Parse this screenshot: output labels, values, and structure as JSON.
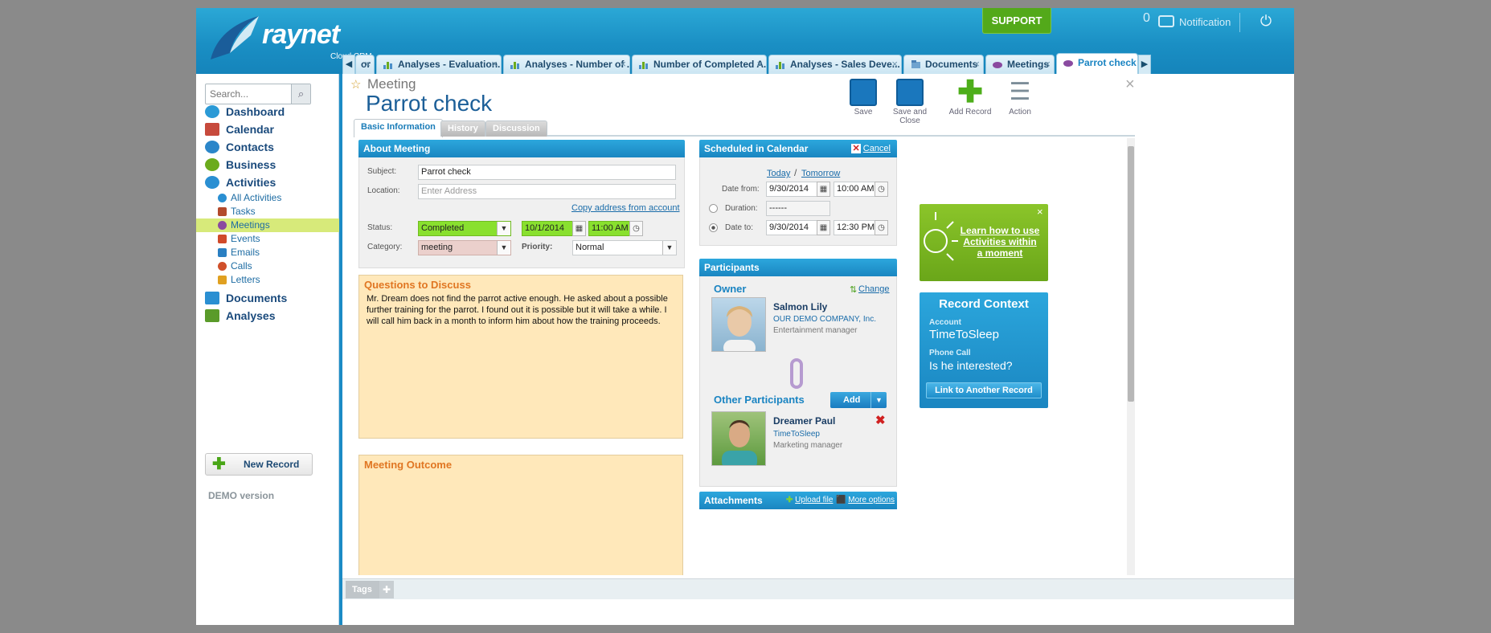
{
  "app": {
    "brand": "raynet",
    "sub": "Cloud CRM"
  },
  "topbar": {
    "support": "SUPPORT",
    "notif_count": "0",
    "notif_label": "Notification"
  },
  "tabs": [
    {
      "label": "or",
      "icon": "chart-icon"
    },
    {
      "label": "Analyses - Evaluation...",
      "icon": "chart-icon"
    },
    {
      "label": "Analyses - Number of ...",
      "icon": "chart-icon"
    },
    {
      "label": "Number of Completed A...",
      "icon": "chart-icon"
    },
    {
      "label": "Analyses - Sales Deve...",
      "icon": "chart-icon"
    },
    {
      "label": "Documents",
      "icon": "document-icon"
    },
    {
      "label": "Meetings",
      "icon": "meeting-icon"
    },
    {
      "label": "Parrot check",
      "icon": "meeting-icon"
    }
  ],
  "sidebar": {
    "search_placeholder": "Search...",
    "nav": [
      {
        "label": "Dashboard",
        "color": "#2b9ad6"
      },
      {
        "label": "Calendar",
        "color": "#c74a3c"
      },
      {
        "label": "Contacts",
        "color": "#2b86c9"
      },
      {
        "label": "Business",
        "color": "#6bab1d"
      },
      {
        "label": "Activities",
        "color": "#2a8fd2"
      },
      {
        "label": "Documents",
        "color": "#2a8fd2"
      },
      {
        "label": "Analyses",
        "color": "#5a9b2a"
      }
    ],
    "subs": [
      {
        "label": "All Activities",
        "color": "#2a8fd2"
      },
      {
        "label": "Tasks",
        "color": "#b24a2c"
      },
      {
        "label": "Meetings",
        "color": "#8a4aa0"
      },
      {
        "label": "Events",
        "color": "#d04a2a"
      },
      {
        "label": "Emails",
        "color": "#2a7fc2"
      },
      {
        "label": "Calls",
        "color": "#d0502a"
      },
      {
        "label": "Letters",
        "color": "#e0a020"
      }
    ],
    "new_record": "New Record",
    "demo": "DEMO version"
  },
  "record": {
    "type": "Meeting",
    "title": "Parrot check",
    "toolbar": {
      "save": "Save",
      "save_close": "Save and Close",
      "add_record": "Add Record",
      "action": "Action"
    },
    "inner_tabs": {
      "basic": "Basic Information",
      "history": "History",
      "discussion": "Discussion"
    }
  },
  "about": {
    "header": "About Meeting",
    "subject_label": "Subject:",
    "subject": "Parrot check",
    "location_label": "Location:",
    "location_placeholder": "Enter Address",
    "copy_address": "Copy address from account",
    "status_label": "Status:",
    "status": "Completed",
    "status_date": "10/1/2014",
    "status_time": "11:00 AM",
    "category_label": "Category:",
    "category": "meeting",
    "priority_label": "Priority:",
    "priority": "Normal"
  },
  "questions": {
    "header": "Questions to Discuss",
    "text": "Mr. Dream does not find the parrot active enough. He asked about a possible further training for the parrot. I found out it is possible but it will take a while. I will call him back in a month to inform him about how the training proceeds."
  },
  "outcome": {
    "header": "Meeting Outcome"
  },
  "schedule": {
    "header": "Scheduled in Calendar",
    "cancel": "Cancel",
    "today": "Today",
    "slash": "/",
    "tomorrow": "Tomorrow",
    "date_from_label": "Date from:",
    "date_from": "9/30/2014",
    "time_from": "10:00 AM",
    "duration_label": "Duration:",
    "duration": "------",
    "date_to_label": "Date to:",
    "date_to": "9/30/2014",
    "time_to": "12:30 PM"
  },
  "participants": {
    "header": "Participants",
    "owner_label": "Owner",
    "change": "Change",
    "owner_name": "Salmon Lily",
    "owner_company": "OUR DEMO COMPANY, Inc.",
    "owner_role": "Entertainment manager",
    "other_label": "Other Participants",
    "add": "Add",
    "other_name": "Dreamer Paul",
    "other_company": "TimeToSleep",
    "other_role": "Marketing manager"
  },
  "attachments": {
    "header": "Attachments",
    "upload": "Upload file",
    "more": "More options"
  },
  "tip": {
    "text": "Learn how to use Activities within a moment"
  },
  "context": {
    "title": "Record Context",
    "account_label": "Account",
    "account": "TimeToSleep",
    "call_label": "Phone Call",
    "call": "Is he interested?",
    "link_btn": "Link to Another Record"
  },
  "tags": {
    "label": "Tags"
  }
}
